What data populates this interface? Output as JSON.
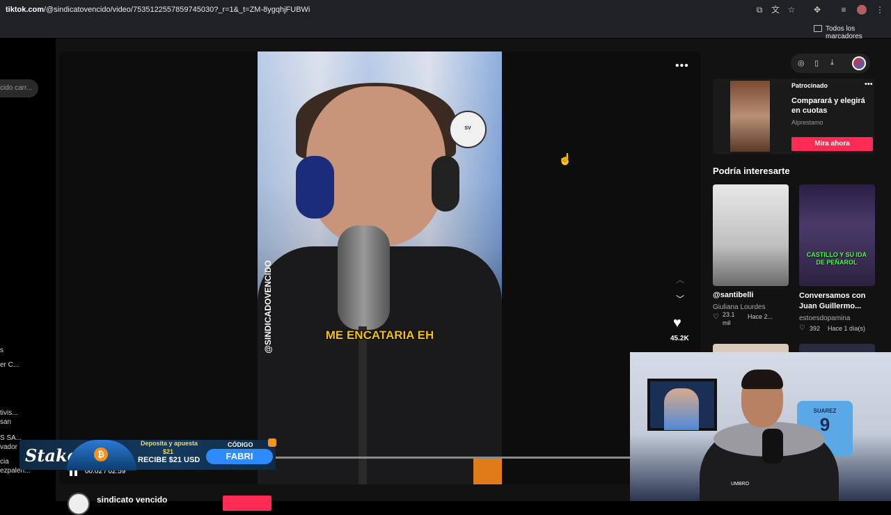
{
  "browser": {
    "url_host": "tiktok.com",
    "url_path": "/@sindicatovencido/video/7535122557859745030?_r=1&_t=ZM-8ygqhjFUBWi",
    "bookmarks_label": "Todos los marcadores"
  },
  "left_sidebar": {
    "search_placeholder": "cido carr...",
    "items": [
      "s",
      "er C...",
      "tivis...",
      "san",
      "S SA...",
      "vador",
      "cia",
      "ezpalen..."
    ]
  },
  "video": {
    "watermark": "@SINDICADOVENCIDO",
    "logo_text": "SV",
    "caption": "ME ENCATARIA EH",
    "time": "00:02 / 02:59",
    "progress": 0.011,
    "like_count": "45.2K"
  },
  "ad": {
    "sponsored_label": "Patrocinado",
    "title": "Comparará y elegirá en cuotas",
    "brand": "Alprestamo",
    "cta": "Mira ahora"
  },
  "recommendations": {
    "section_title": "Podría interesarte",
    "items": [
      {
        "title": "@santibelli",
        "author": "Giuliana Lourdes",
        "likes": "23.1 mil",
        "date": "Hace 2..."
      },
      {
        "title": "Conversamos con Juan Guillermo...",
        "author": "estoesdopamina",
        "likes": "392",
        "date": "Hace 1 día(s)",
        "overlay": "CASTILLO Y SU IDA DE PEÑAROL"
      }
    ]
  },
  "stream_overlay": {
    "brand": "Stake",
    "promo_line1": "Deposita y apuesta",
    "promo_amount": "$21",
    "promo_line2": "RECIBE $21 USD",
    "code_label": "CÓDIGO",
    "code": "FABRI",
    "jersey_name": "SUAREZ",
    "jersey_number": "9",
    "hoodie_brand": "UMBRO"
  },
  "author": {
    "name": "sindicato vencido"
  },
  "icons": [
    "extension-icon",
    "translate-icon",
    "star-icon",
    "puzzle-icon",
    "media-icon",
    "profile-icon",
    "menu-icon",
    "folder-icon",
    "compass-icon",
    "phone-icon",
    "download-icon",
    "more-icon",
    "chevron-up-icon",
    "chevron-down-icon",
    "heart-icon",
    "pause-icon",
    "cursor-icon"
  ],
  "colors": {
    "accent": "#fe2c55",
    "caption": "#f5c400",
    "browser_bg": "#202124"
  }
}
